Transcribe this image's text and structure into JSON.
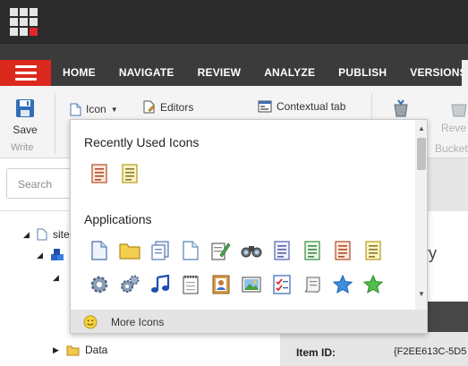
{
  "header": {
    "launchpad_icon": "grid-launchpad-icon",
    "menu_icon": "hamburger-icon",
    "tabs": [
      "HOME",
      "NAVIGATE",
      "REVIEW",
      "ANALYZE",
      "PUBLISH",
      "VERSIONS"
    ]
  },
  "ribbon": {
    "save_label": "Save",
    "write_group": "Write",
    "icon_label": "Icon",
    "editors_label": "Editors",
    "contextual_tab_label": "Contextual tab",
    "reverse_label": "Reve",
    "bucket_label": "Bucket"
  },
  "search": {
    "placeholder": "Search"
  },
  "tree": {
    "root": "site",
    "data": "Data"
  },
  "right": {
    "heading_fragment": "ory",
    "item_id_label": "Item ID:",
    "item_id_value": "{F2EE613C-5D5"
  },
  "dropdown": {
    "recent_title": "Recently Used Icons",
    "recent_icons": [
      "document-red-lines-icon",
      "document-yellow-lines-icon"
    ],
    "apps_title": "Applications",
    "app_icons_row1": [
      "document-icon",
      "folder-icon",
      "documents-icon",
      "blank-page-icon",
      "document-pencil-icon",
      "binoculars-icon",
      "document-blue-lines-icon",
      "document-green-lines-icon",
      "document-red-lines-icon",
      "document-yellow-lines-icon"
    ],
    "app_icons_row2": [
      "gear-icon",
      "gears-icon",
      "music-note-icon",
      "notepad-icon",
      "contact-card-icon",
      "picture-icon",
      "checklist-icon",
      "scroll-icon",
      "blue-star-icon",
      "green-star-icon"
    ],
    "more_label": "More Icons"
  },
  "colors": {
    "accent_red": "#dc291e",
    "topbar": "#2b2b2b",
    "navbar": "#3b3b3b"
  }
}
